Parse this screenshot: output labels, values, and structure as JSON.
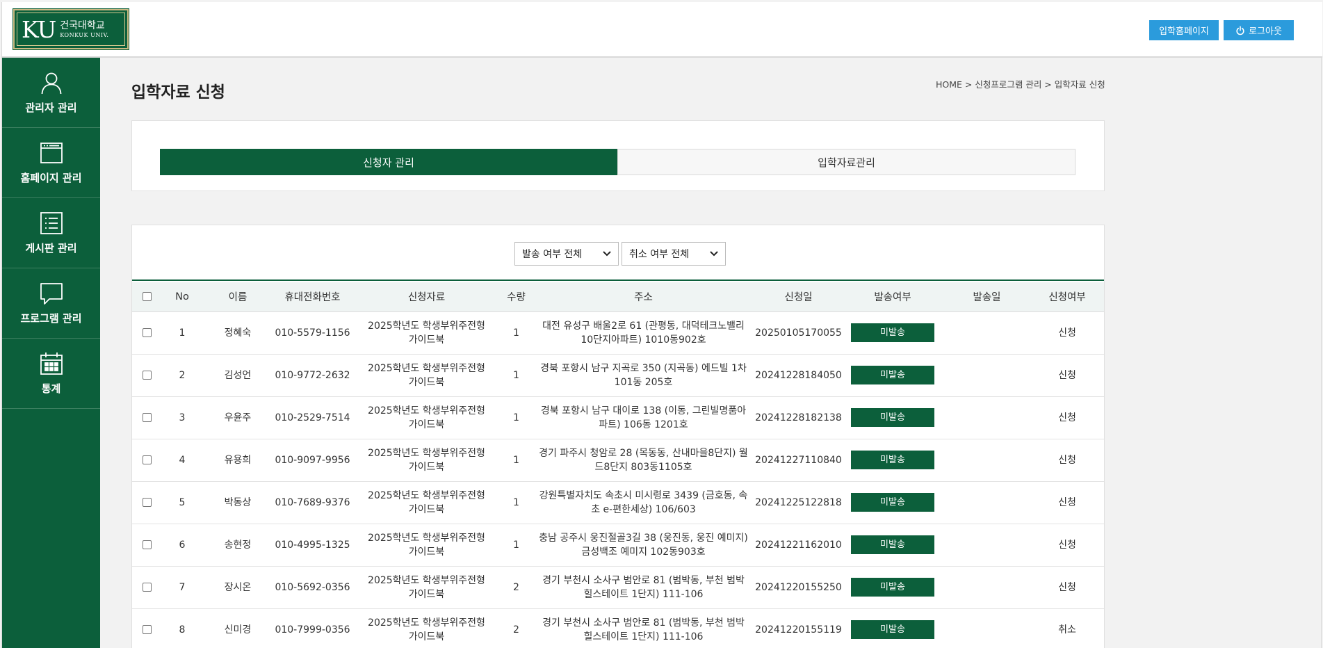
{
  "header": {
    "logo": {
      "ku": "KU",
      "korean": "건국대학교",
      "english": "KONKUK UNIV."
    },
    "home_button": "입학홈페이지",
    "logout_button": "로그아웃"
  },
  "sidebar": {
    "items": [
      {
        "label": "관리자 관리",
        "icon": "user-icon"
      },
      {
        "label": "홈페이지 관리",
        "icon": "browser-window-icon"
      },
      {
        "label": "게시판 관리",
        "icon": "list-icon"
      },
      {
        "label": "프로그램 관리",
        "icon": "speech-bubble-icon"
      },
      {
        "label": "통계",
        "icon": "calendar-icon"
      }
    ]
  },
  "page": {
    "title": "입학자료 신청",
    "breadcrumb": "HOME > 신청프로그램 관리 > 입학자료 신청"
  },
  "tabs": [
    {
      "label": "신청자 관리",
      "active": true
    },
    {
      "label": "입학자료관리",
      "active": false
    }
  ],
  "filters": {
    "send_status": "발송 여부 전체",
    "cancel_status": "취소 여부 전체"
  },
  "table": {
    "headers": [
      "No",
      "이름",
      "휴대전화번호",
      "신청자료",
      "수량",
      "주소",
      "신청일",
      "발송여부",
      "발송일",
      "신청여부"
    ],
    "rows": [
      {
        "no": "1",
        "name": "정혜숙",
        "phone": "010-5579-1156",
        "item1": "2025학년도 학생부위주전형",
        "item2": "가이드북",
        "qty": "1",
        "addr1": "대전 유성구 배울2로 61 (관평동, 대덕테크노밸리",
        "addr2": "10단지아파트) 1010동902호",
        "date": "20250105170055",
        "status": "미발송",
        "sent": "",
        "req": "신청"
      },
      {
        "no": "2",
        "name": "김성언",
        "phone": "010-9772-2632",
        "item1": "2025학년도 학생부위주전형",
        "item2": "가이드북",
        "qty": "1",
        "addr1": "경북 포항시 남구 지곡로 350 (지곡동) 에드빌 1차",
        "addr2": "101동 205호",
        "date": "20241228184050",
        "status": "미발송",
        "sent": "",
        "req": "신청"
      },
      {
        "no": "3",
        "name": "우윤주",
        "phone": "010-2529-7514",
        "item1": "2025학년도 학생부위주전형",
        "item2": "가이드북",
        "qty": "1",
        "addr1": "경북 포항시 남구 대이로 138 (이동, 그린빌명품아",
        "addr2": "파트) 106동 1201호",
        "date": "20241228182138",
        "status": "미발송",
        "sent": "",
        "req": "신청"
      },
      {
        "no": "4",
        "name": "유용희",
        "phone": "010-9097-9956",
        "item1": "2025학년도 학생부위주전형",
        "item2": "가이드북",
        "qty": "1",
        "addr1": "경기 파주시 청암로 28 (목동동, 산내마을8단지) 월",
        "addr2": "드8단지 803동1105호",
        "date": "20241227110840",
        "status": "미발송",
        "sent": "",
        "req": "신청"
      },
      {
        "no": "5",
        "name": "박동상",
        "phone": "010-7689-9376",
        "item1": "2025학년도 학생부위주전형",
        "item2": "가이드북",
        "qty": "1",
        "addr1": "강원특별자치도 속초시 미시령로 3439 (금호동, 속",
        "addr2": "초 e-편한세상) 106/603",
        "date": "20241225122818",
        "status": "미발송",
        "sent": "",
        "req": "신청"
      },
      {
        "no": "6",
        "name": "송현정",
        "phone": "010-4995-1325",
        "item1": "2025학년도 학생부위주전형",
        "item2": "가이드북",
        "qty": "1",
        "addr1": "충남 공주시 웅진절골3길 38 (웅진동, 웅진 예미지)",
        "addr2": "금성백조 예미지 102동903호",
        "date": "20241221162010",
        "status": "미발송",
        "sent": "",
        "req": "신청"
      },
      {
        "no": "7",
        "name": "장시온",
        "phone": "010-5692-0356",
        "item1": "2025학년도 학생부위주전형",
        "item2": "가이드북",
        "qty": "2",
        "addr1": "경기 부천시 소사구 범안로 81 (범박동, 부천 범박",
        "addr2": "힐스테이트 1단지) 111-106",
        "date": "20241220155250",
        "status": "미발송",
        "sent": "",
        "req": "신청"
      },
      {
        "no": "8",
        "name": "신미경",
        "phone": "010-7999-0356",
        "item1": "2025학년도 학생부위주전형",
        "item2": "가이드북",
        "qty": "2",
        "addr1": "경기 부천시 소사구 범안로 81 (범박동, 부천 범박",
        "addr2": "힐스테이트 1단지) 111-106",
        "date": "20241220155119",
        "status": "미발송",
        "sent": "",
        "req": "취소"
      }
    ]
  },
  "colors": {
    "primary_green": "#0c5f3b",
    "header_button_blue": "#2b9bdc",
    "logo_gold": "#cbb981"
  }
}
